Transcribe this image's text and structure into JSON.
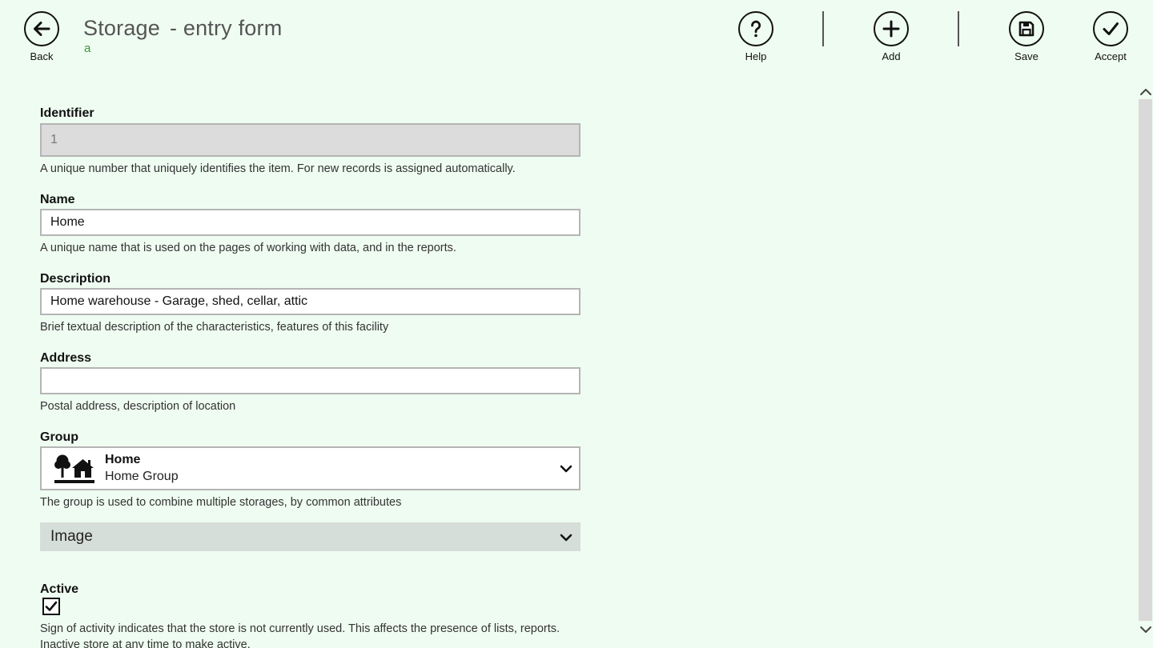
{
  "header": {
    "back_label": "Back",
    "title": "Storage",
    "title_suffix": "- entry form",
    "subtitle": "a",
    "help_label": "Help",
    "add_label": "Add",
    "save_label": "Save",
    "accept_label": "Accept"
  },
  "form": {
    "identifier": {
      "label": "Identifier",
      "value": "1",
      "hint": "A unique number that uniquely identifies the item. For new records is assigned automatically."
    },
    "name": {
      "label": "Name",
      "value": "Home",
      "hint": "A unique name that is used on the pages of working with data, and in the reports."
    },
    "description": {
      "label": "Description",
      "value": "Home warehouse - Garage, shed, cellar, attic",
      "hint": "Brief textual description of the characteristics, features of this facility"
    },
    "address": {
      "label": "Address",
      "value": "",
      "hint": "Postal address, description of location"
    },
    "group": {
      "label": "Group",
      "selected_title": "Home",
      "selected_subtitle": "Home Group",
      "icon": "home-group-icon",
      "hint": "The group is used to combine multiple storages, by common attributes"
    },
    "image": {
      "label": "Image"
    },
    "active": {
      "label": "Active",
      "checked": true,
      "hint_line1": "Sign of activity indicates that the store is not currently used. This affects the presence of lists, reports.",
      "hint_line2": "Inactive store at any time to make active."
    }
  },
  "colors": {
    "background": "#effcf1",
    "subtitle": "#3a9a3a",
    "readonly_field": "#dcdcdc",
    "image_dropdown": "#d6ded9",
    "scrollbar_track": "#d9d9d9"
  }
}
